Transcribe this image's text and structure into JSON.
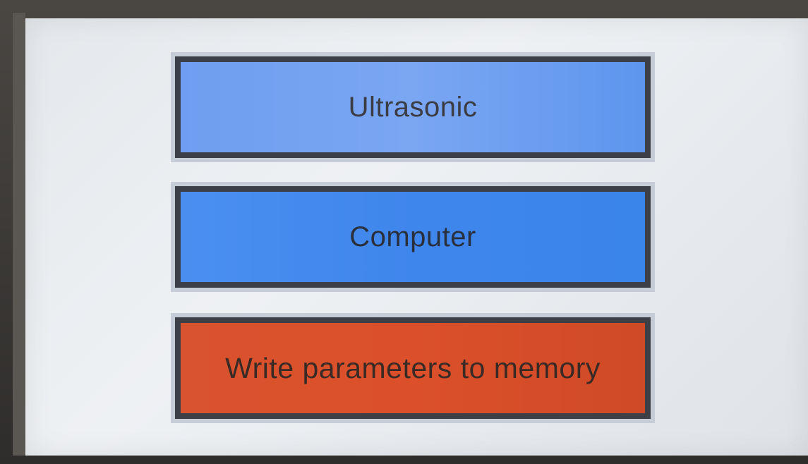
{
  "menu": {
    "buttons": [
      {
        "label": "Ultrasonic",
        "color": "#6f9ef0"
      },
      {
        "label": "Computer",
        "color": "#3f86ec"
      },
      {
        "label": "Write parameters to memory",
        "color": "#d9532e"
      }
    ]
  }
}
